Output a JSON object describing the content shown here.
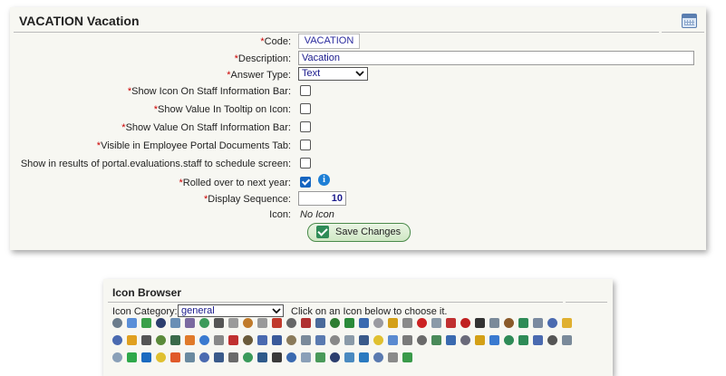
{
  "main_panel": {
    "title": "VACATION Vacation",
    "required_marker": "*",
    "fields": {
      "code": {
        "label": "Code:",
        "value": "VACATION"
      },
      "description": {
        "label": "Description:",
        "value": "Vacation"
      },
      "answer_type": {
        "label": "Answer Type:",
        "value": "Text"
      },
      "show_icon_bar": {
        "label": "Show Icon On Staff Information Bar:",
        "checked": false
      },
      "show_value_tooltip": {
        "label": "Show Value In Tooltip on Icon:",
        "checked": false
      },
      "show_value_bar": {
        "label": "Show Value On Staff Information Bar:",
        "checked": false
      },
      "visible_portal": {
        "label": "Visible in Employee Portal Documents Tab:",
        "checked": false
      },
      "show_in_results": {
        "label": "Show in results of portal.evaluations.staff to schedule screen:",
        "checked": false
      },
      "rolled_over": {
        "label": "Rolled over to next year:",
        "checked": true
      },
      "display_sequence": {
        "label": "Display Sequence:",
        "value": "10"
      },
      "icon": {
        "label": "Icon:",
        "value": "No Icon"
      }
    },
    "save_label": "Save Changes"
  },
  "icon_browser": {
    "title": "Icon Browser",
    "category_label": "Icon Category:",
    "category_value": "general",
    "hint": "Click on an Icon below to choose it.",
    "rows": [
      [
        "#6b7c8c",
        "#5a8fd8",
        "#3aa04a",
        "#2c3e6e",
        "#6a8fb5",
        "#7a6aa0",
        "#3c9a5a",
        "#555555",
        "#9a9a9a",
        "#c07a2a",
        "#999999",
        "#c0392b",
        "#666666",
        "#b03030",
        "#4a6a9a",
        "#2e7d32",
        "#2a8a3a",
        "#3a6ab0",
        "#9a9aa0",
        "#d4a017",
        "#8a8a8a",
        "#cc2222",
        "#8a9aa8",
        "#c03030",
        "#c02020",
        "#333333",
        "#7a8a9a",
        "#8a5a2a",
        "#2e8b57",
        "#7a8aa0",
        "#4a6ab0",
        "#e0b030"
      ],
      [
        "#4a6ab0",
        "#e0a020",
        "#555555",
        "#5a8a3a",
        "#3a6a4a",
        "#e07a2a",
        "#3a7ad0",
        "#888888",
        "#c03030",
        "#6a5a3a",
        "#4a6ab0",
        "#3a5a9a",
        "#8a7a5a",
        "#7a8a9a",
        "#5a7ab0",
        "#888888",
        "#8a9aa8",
        "#3a5a8a",
        "#e0c030",
        "#5a8ad0",
        "#7a7a7a",
        "#6a6a6a",
        "#4a8a5a",
        "#3a6ab0",
        "#6a6a7a",
        "#d4a017",
        "#3a7ad0",
        "#2e8b57",
        "#2e8b57",
        "#4a6ab0",
        "#555555",
        "#7a8a9a"
      ],
      [
        "#8aa0b8",
        "#2ea84a",
        "#1a6ac0",
        "#e0c030",
        "#e05a2a",
        "#6a8aa0",
        "#4a6ab0",
        "#3a5a8a",
        "#6a6a6a",
        "#3a9a5a",
        "#2e5a8a",
        "#3a3a3a",
        "#3a6ab0",
        "#8aa0b8",
        "#4a9a5a",
        "#2c3e6e",
        "#4a8ac0",
        "#2a7ac0",
        "#5a7ab0",
        "#8a8a8a",
        "#3a9a4a"
      ]
    ]
  }
}
